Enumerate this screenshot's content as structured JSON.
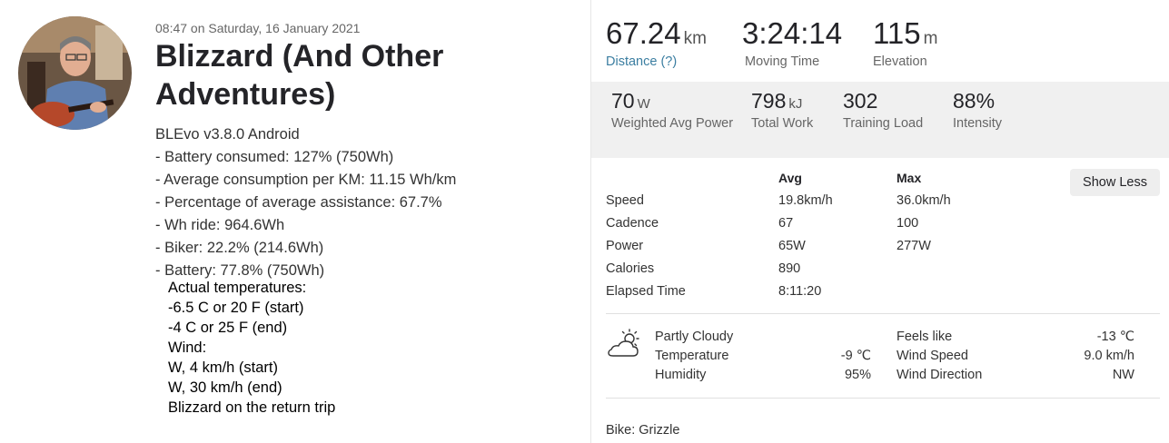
{
  "activity": {
    "timestamp": "08:47 on Saturday, 16 January 2021",
    "title": "Blizzard (And Other Adventures)",
    "description_lines": [
      "BLEvo v3.8.0 Android",
      "- Battery consumed: 127% (750Wh)",
      "- Average consumption per KM: 11.15 Wh/km",
      "- Percentage of average assistance: 67.7%",
      "- Wh ride: 964.6Wh",
      "- Biker: 22.2% (214.6Wh)",
      "- Battery: 77.8% (750Wh)"
    ],
    "note_lines": [
      "Actual temperatures:",
      "-6.5 C or 20 F (start)",
      "-4 C or 25 F (end)",
      "Wind:",
      "W, 4 km/h (start)",
      "W, 30 km/h (end)",
      "Blizzard on the return trip"
    ]
  },
  "primary_stats": {
    "distance": {
      "value": "67.24",
      "unit": "km",
      "label": "Distance (?)"
    },
    "moving_time": {
      "value": "3:24:14",
      "label": "Moving Time"
    },
    "elevation": {
      "value": "115",
      "unit": "m",
      "label": "Elevation"
    }
  },
  "secondary_stats": {
    "weighted_power": {
      "value": "70",
      "unit": "W",
      "label": "Weighted Avg Power"
    },
    "total_work": {
      "value": "798",
      "unit": "kJ",
      "label": "Total Work"
    },
    "training_load": {
      "value": "302",
      "label": "Training Load"
    },
    "intensity": {
      "value": "88%",
      "label": "Intensity"
    }
  },
  "details": {
    "header_avg": "Avg",
    "header_max": "Max",
    "show_less_label": "Show Less",
    "rows": [
      {
        "label": "Speed",
        "avg": "19.8km/h",
        "max": "36.0km/h"
      },
      {
        "label": "Cadence",
        "avg": "67",
        "max": "100"
      },
      {
        "label": "Power",
        "avg": "65W",
        "max": "277W"
      },
      {
        "label": "Calories",
        "avg": "890",
        "max": ""
      },
      {
        "label": "Elapsed Time",
        "avg": "8:11:20",
        "max": ""
      }
    ]
  },
  "weather": {
    "icon": "partly-cloudy-icon",
    "condition": "Partly Cloudy",
    "temperature_label": "Temperature",
    "temperature_value": "-9 ℃",
    "humidity_label": "Humidity",
    "humidity_value": "95%",
    "feels_like_label": "Feels like",
    "feels_like_value": "-13 ℃",
    "wind_speed_label": "Wind Speed",
    "wind_speed_value": "9.0 km/h",
    "wind_direction_label": "Wind Direction",
    "wind_direction_value": "NW"
  },
  "bike": "Bike: Grizzle"
}
